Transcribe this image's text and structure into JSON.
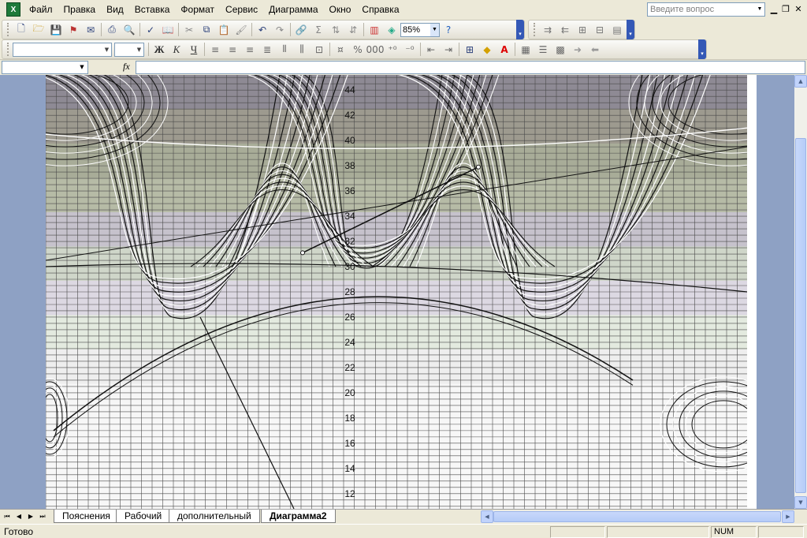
{
  "menubar": {
    "items": [
      "Файл",
      "Правка",
      "Вид",
      "Вставка",
      "Формат",
      "Сервис",
      "Диаграмма",
      "Окно",
      "Справка"
    ],
    "help_placeholder": "Введите вопрос"
  },
  "toolbar": {
    "zoom": "85%"
  },
  "formatting": {
    "bold": "Ж",
    "italic": "К",
    "underline": "Ч"
  },
  "formula_bar": {
    "fx_label": "fx"
  },
  "chart_data": {
    "type": "line",
    "ytick_labels": [
      "12",
      "14",
      "16",
      "18",
      "20",
      "22",
      "24",
      "26",
      "28",
      "30",
      "32",
      "34",
      "36",
      "38",
      "40",
      "42",
      "44"
    ],
    "ylim": [
      10.8,
      45.2
    ],
    "grid": true
  },
  "sheet_tabs": [
    "Пояснения",
    "Рабочий",
    "дополнительный",
    "Диаграмма2"
  ],
  "active_tab": "Диаграмма2",
  "statusbar": {
    "status": "Готово",
    "num_indicator": "NUM"
  }
}
